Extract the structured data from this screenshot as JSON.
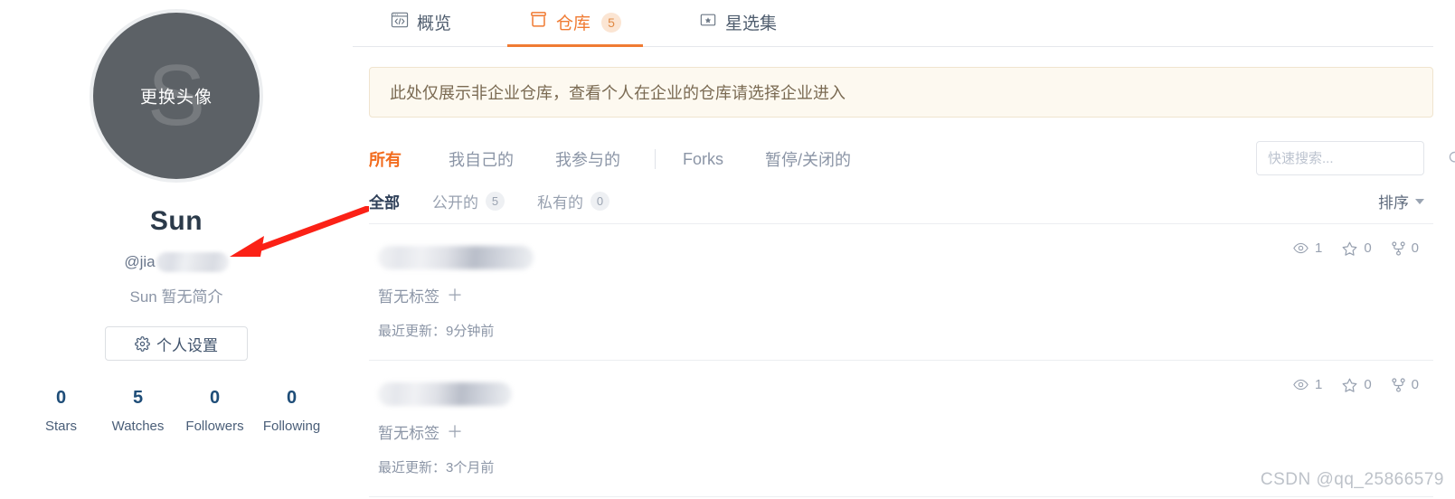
{
  "profile": {
    "avatar_letter": "S",
    "avatar_overlay_label": "更换头像",
    "display_name": "Sun",
    "username_prefix": "@jia",
    "bio": "Sun 暂无简介",
    "settings_button_label": "个人设置",
    "stats": [
      {
        "value": "0",
        "label": "Stars"
      },
      {
        "value": "5",
        "label": "Watches"
      },
      {
        "value": "0",
        "label": "Followers"
      },
      {
        "value": "0",
        "label": "Following"
      }
    ]
  },
  "tabs": [
    {
      "label": "概览",
      "icon": "code-window-icon",
      "badge": "",
      "active": false
    },
    {
      "label": "仓库",
      "icon": "repository-icon",
      "badge": "5",
      "active": true
    },
    {
      "label": "星选集",
      "icon": "star-box-icon",
      "badge": "",
      "active": false
    }
  ],
  "notice": {
    "text": "此处仅展示非企业仓库，查看个人在企业的仓库请选择企业进入"
  },
  "filters": {
    "items": [
      {
        "label": "所有",
        "active": true
      },
      {
        "label": "我自己的",
        "active": false
      },
      {
        "label": "我参与的",
        "active": false
      },
      {
        "label": "Forks",
        "active": false,
        "after_separator": true
      },
      {
        "label": "暂停/关闭的",
        "active": false
      }
    ]
  },
  "search": {
    "placeholder": "快速搜索...",
    "value": "",
    "icon": "search-icon"
  },
  "subfilters": {
    "items": [
      {
        "label": "全部",
        "count": "",
        "active": true
      },
      {
        "label": "公开的",
        "count": "5",
        "active": false
      },
      {
        "label": "私有的",
        "count": "0",
        "active": false
      }
    ],
    "sort_label": "排序"
  },
  "repositories": [
    {
      "name_redacted": true,
      "name_width": 172,
      "tags_label": "暂无标签",
      "add_tag_icon": "plus-icon",
      "updated_label": "最近更新：9分钟前",
      "watches": "1",
      "stars": "0",
      "forks": "0"
    },
    {
      "name_redacted": true,
      "name_width": 148,
      "tags_label": "暂无标签",
      "add_tag_icon": "plus-icon",
      "updated_label": "最近更新：3个月前",
      "watches": "1",
      "stars": "0",
      "forks": "0"
    }
  ],
  "watermark": "CSDN @qq_25866579",
  "colors": {
    "accent": "#f07b33",
    "filter_active": "#f26b1d",
    "stat_number": "#1e4d78",
    "notice_bg": "#fdf9f0",
    "notice_border": "#f0e4cf",
    "annotation_arrow": "#fb2116"
  }
}
